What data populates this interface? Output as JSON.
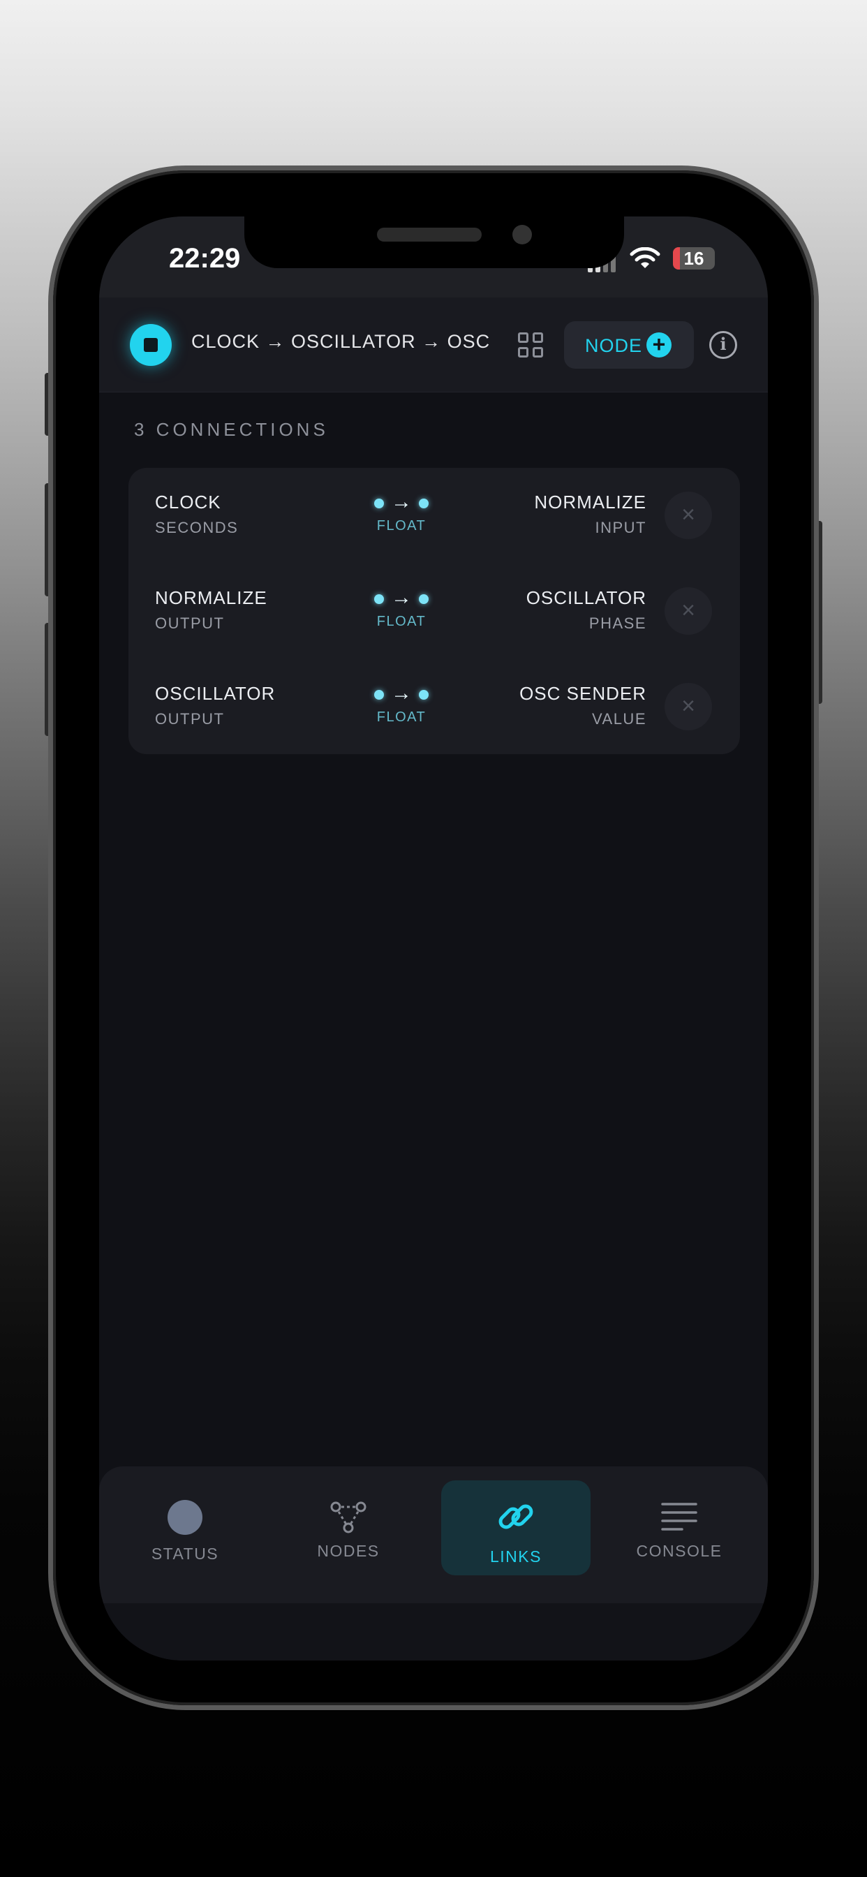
{
  "status_bar": {
    "time": "22:29",
    "battery": "16"
  },
  "header": {
    "pipeline": "CLOCK → OSCILLATOR → OSC",
    "node_button_label": "NODE",
    "node_button_plus": "+",
    "info_glyph": "i",
    "icons": [
      "stop-icon",
      "grid-icon",
      "plus-icon",
      "info-icon"
    ]
  },
  "connections": {
    "title": "3 CONNECTIONS",
    "rows": [
      {
        "source_node": "CLOCK",
        "source_port": "SECONDS",
        "type": "FLOAT",
        "target_node": "NORMALIZE",
        "target_port": "INPUT"
      },
      {
        "source_node": "NORMALIZE",
        "source_port": "OUTPUT",
        "type": "FLOAT",
        "target_node": "OSCILLATOR",
        "target_port": "PHASE"
      },
      {
        "source_node": "OSCILLATOR",
        "source_port": "OUTPUT",
        "type": "FLOAT",
        "target_node": "OSC SENDER",
        "target_port": "VALUE"
      }
    ],
    "delete_glyph": "×"
  },
  "tabs": [
    {
      "label": "STATUS",
      "icon": "status-icon"
    },
    {
      "label": "NODES",
      "icon": "nodes-icon"
    },
    {
      "label": "LINKS",
      "icon": "link-icon",
      "active": true
    },
    {
      "label": "CONSOLE",
      "icon": "menu-icon"
    }
  ],
  "colors": {
    "accent": "#22d3ee",
    "background": "#101116",
    "card": "#1b1c22",
    "battery_low": "#e5484d"
  }
}
